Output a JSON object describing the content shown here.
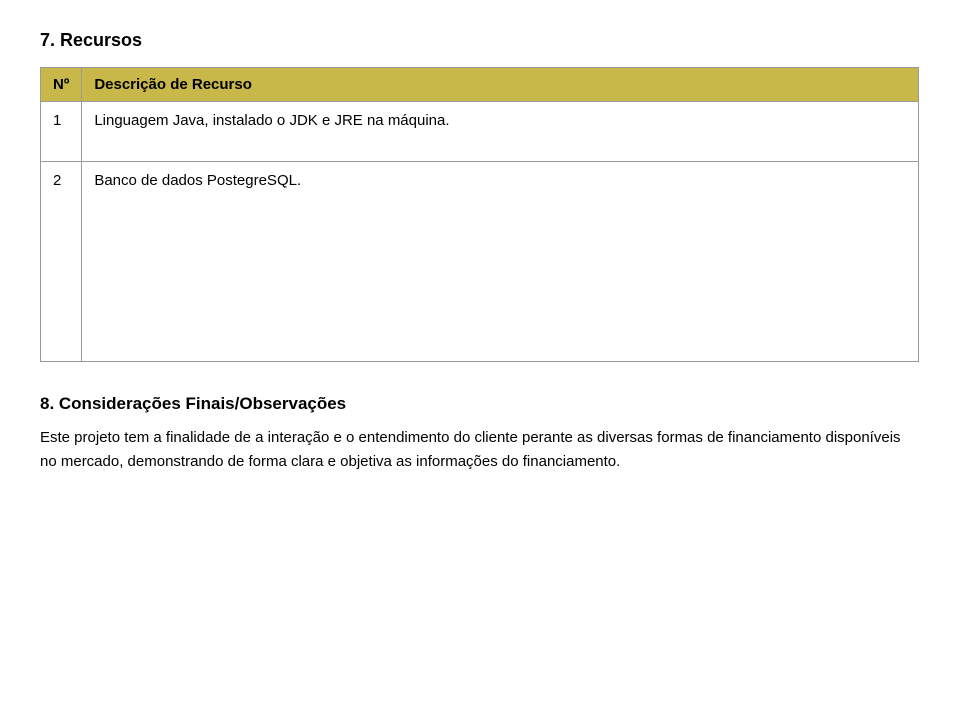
{
  "page": {
    "section7_title": "7. Recursos",
    "table": {
      "col_num_header": "Nº",
      "col_desc_header": "Descrição de Recurso",
      "rows": [
        {
          "num": "1",
          "description": "Linguagem Java, instalado o JDK e JRE na máquina."
        },
        {
          "num": "2",
          "description": "Banco de dados PostegreSQL."
        }
      ]
    },
    "section8_title": "8. Considerações Finais/Observações",
    "section8_body": "Este projeto tem a finalidade de a interação e o entendimento do cliente perante as diversas formas de financiamento disponíveis no mercado, demonstrando de forma clara e objetiva as informações do financiamento."
  }
}
